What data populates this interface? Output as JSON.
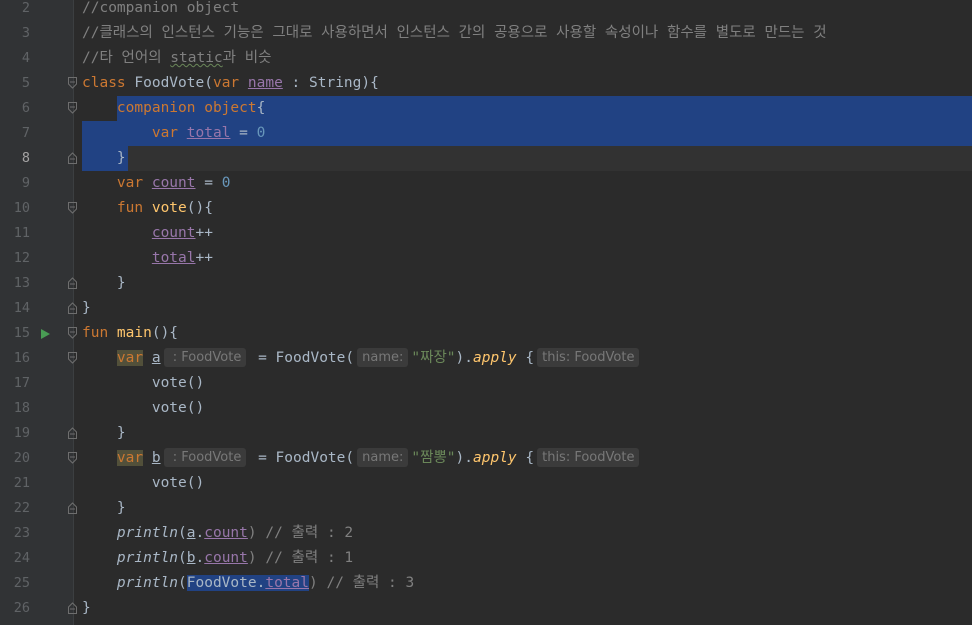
{
  "editor": {
    "lines": [
      {
        "n": "2",
        "tokens": [
          {
            "t": "//companion object",
            "c": "cm"
          }
        ]
      },
      {
        "n": "3",
        "tokens": [
          {
            "t": "//클래스의 인스턴스 기능은 그대로 사용하면서 인스턴스 간의 공용으로 사용할 속성이나 함수를 별도로 만드는 것",
            "c": "cm"
          }
        ]
      },
      {
        "n": "4",
        "tokens": [
          {
            "t": "//타 언어의 ",
            "c": "cm"
          },
          {
            "t": "static",
            "c": "cm static-un"
          },
          {
            "t": "과 비슷",
            "c": "cm"
          }
        ]
      },
      {
        "n": "5",
        "fold": "open",
        "tokens": [
          {
            "t": "class ",
            "c": "kw"
          },
          {
            "t": "FoodVote(",
            "c": "plain"
          },
          {
            "t": "var ",
            "c": "kw"
          },
          {
            "t": "name",
            "c": "prop"
          },
          {
            "t": " : String){",
            "c": "plain"
          }
        ]
      },
      {
        "n": "6",
        "fold": "open",
        "tokens": [
          {
            "t": "    "
          },
          {
            "t": "companion object",
            "c": "kw"
          },
          {
            "t": "{",
            "c": "plain"
          }
        ]
      },
      {
        "n": "7",
        "tokens": [
          {
            "t": "        "
          },
          {
            "t": "var ",
            "c": "kw"
          },
          {
            "t": "total",
            "c": "prop"
          },
          {
            "t": " = ",
            "c": "plain"
          },
          {
            "t": "0",
            "c": "num"
          }
        ]
      },
      {
        "n": "8",
        "fold": "close",
        "tokens": [
          {
            "t": "    "
          },
          {
            "t": "}",
            "c": "plain"
          }
        ]
      },
      {
        "n": "9",
        "tokens": [
          {
            "t": "    "
          },
          {
            "t": "var ",
            "c": "kw"
          },
          {
            "t": "count",
            "c": "prop"
          },
          {
            "t": " = ",
            "c": "plain"
          },
          {
            "t": "0",
            "c": "num"
          }
        ]
      },
      {
        "n": "10",
        "fold": "open",
        "tokens": [
          {
            "t": "    "
          },
          {
            "t": "fun ",
            "c": "kw"
          },
          {
            "t": "vote",
            "c": "fn"
          },
          {
            "t": "(){",
            "c": "plain"
          }
        ]
      },
      {
        "n": "11",
        "tokens": [
          {
            "t": "        "
          },
          {
            "t": "count",
            "c": "prop"
          },
          {
            "t": "++",
            "c": "plain"
          }
        ]
      },
      {
        "n": "12",
        "tokens": [
          {
            "t": "        "
          },
          {
            "t": "total",
            "c": "prop"
          },
          {
            "t": "++",
            "c": "plain"
          }
        ]
      },
      {
        "n": "13",
        "fold": "close",
        "tokens": [
          {
            "t": "    "
          },
          {
            "t": "}",
            "c": "plain"
          }
        ]
      },
      {
        "n": "14",
        "fold": "close",
        "tokens": [
          {
            "t": "}",
            "c": "plain"
          }
        ]
      },
      {
        "n": "15",
        "run": true,
        "fold": "open",
        "tokens": [
          {
            "t": "fun ",
            "c": "kw"
          },
          {
            "t": "main",
            "c": "fn"
          },
          {
            "t": "(){",
            "c": "plain"
          }
        ]
      },
      {
        "n": "16",
        "fold": "open",
        "tokens": [
          {
            "t": "    "
          },
          {
            "t": "var",
            "c": "kw var-hl"
          },
          {
            "t": " "
          },
          {
            "t": "a",
            "c": "plain uline"
          },
          {
            "t": " : FoodVote",
            "c": "hint"
          },
          {
            "t": " = FoodVote(",
            "c": "plain"
          },
          {
            "t": "name:",
            "c": "hint"
          },
          {
            "t": "\"짜장\"",
            "c": "str"
          },
          {
            "t": ").",
            "c": "plain"
          },
          {
            "t": "apply",
            "c": "fnital"
          },
          {
            "t": " {",
            "c": "plain"
          },
          {
            "t": "this: FoodVote",
            "c": "hint"
          }
        ]
      },
      {
        "n": "17",
        "tokens": [
          {
            "t": "        "
          },
          {
            "t": "vote()",
            "c": "plain"
          }
        ]
      },
      {
        "n": "18",
        "tokens": [
          {
            "t": "        "
          },
          {
            "t": "vote()",
            "c": "plain"
          }
        ]
      },
      {
        "n": "19",
        "fold": "close",
        "tokens": [
          {
            "t": "    "
          },
          {
            "t": "}",
            "c": "plain"
          }
        ]
      },
      {
        "n": "20",
        "fold": "open",
        "tokens": [
          {
            "t": "    "
          },
          {
            "t": "var",
            "c": "kw var-hl"
          },
          {
            "t": " "
          },
          {
            "t": "b",
            "c": "plain uline"
          },
          {
            "t": " : FoodVote",
            "c": "hint"
          },
          {
            "t": " = FoodVote(",
            "c": "plain"
          },
          {
            "t": "name:",
            "c": "hint"
          },
          {
            "t": "\"짬뽕\"",
            "c": "str"
          },
          {
            "t": ").",
            "c": "plain"
          },
          {
            "t": "apply",
            "c": "fnital"
          },
          {
            "t": " {",
            "c": "plain"
          },
          {
            "t": "this: FoodVote",
            "c": "hint"
          }
        ]
      },
      {
        "n": "21",
        "tokens": [
          {
            "t": "        "
          },
          {
            "t": "vote()",
            "c": "plain"
          }
        ]
      },
      {
        "n": "22",
        "fold": "close",
        "tokens": [
          {
            "t": "    "
          },
          {
            "t": "}",
            "c": "plain"
          }
        ]
      },
      {
        "n": "23",
        "tokens": [
          {
            "t": "    "
          },
          {
            "t": "println",
            "c": "plain italic"
          },
          {
            "t": "(",
            "c": "plain"
          },
          {
            "t": "a",
            "c": "plain uline"
          },
          {
            "t": ".",
            "c": "plain"
          },
          {
            "t": "count",
            "c": "prop"
          },
          {
            "t": ") // 출력 : 2",
            "c": "cm"
          }
        ]
      },
      {
        "n": "24",
        "tokens": [
          {
            "t": "    "
          },
          {
            "t": "println",
            "c": "plain italic"
          },
          {
            "t": "(",
            "c": "plain"
          },
          {
            "t": "b",
            "c": "plain uline"
          },
          {
            "t": ".",
            "c": "plain"
          },
          {
            "t": "count",
            "c": "prop"
          },
          {
            "t": ") // 출력 : 1",
            "c": "cm"
          }
        ]
      },
      {
        "n": "25",
        "tokens": [
          {
            "t": "    "
          },
          {
            "t": "println",
            "c": "plain italic"
          },
          {
            "t": "(",
            "c": "plain"
          },
          {
            "t": "FoodVote.",
            "c": "plain sel-tok"
          },
          {
            "t": "total",
            "c": "prop sel-tok"
          },
          {
            "t": ") // 출력 : 3",
            "c": "cm"
          }
        ]
      },
      {
        "n": "26",
        "fold": "close",
        "tokens": [
          {
            "t": "}",
            "c": "plain"
          }
        ]
      }
    ]
  },
  "colors": {
    "background": "#2b2b2b",
    "selection": "#214283",
    "keyword": "#cc7832",
    "comment": "#808080",
    "string": "#6a8759",
    "number": "#6897bb",
    "property": "#9876aa",
    "function": "#ffc66d"
  }
}
